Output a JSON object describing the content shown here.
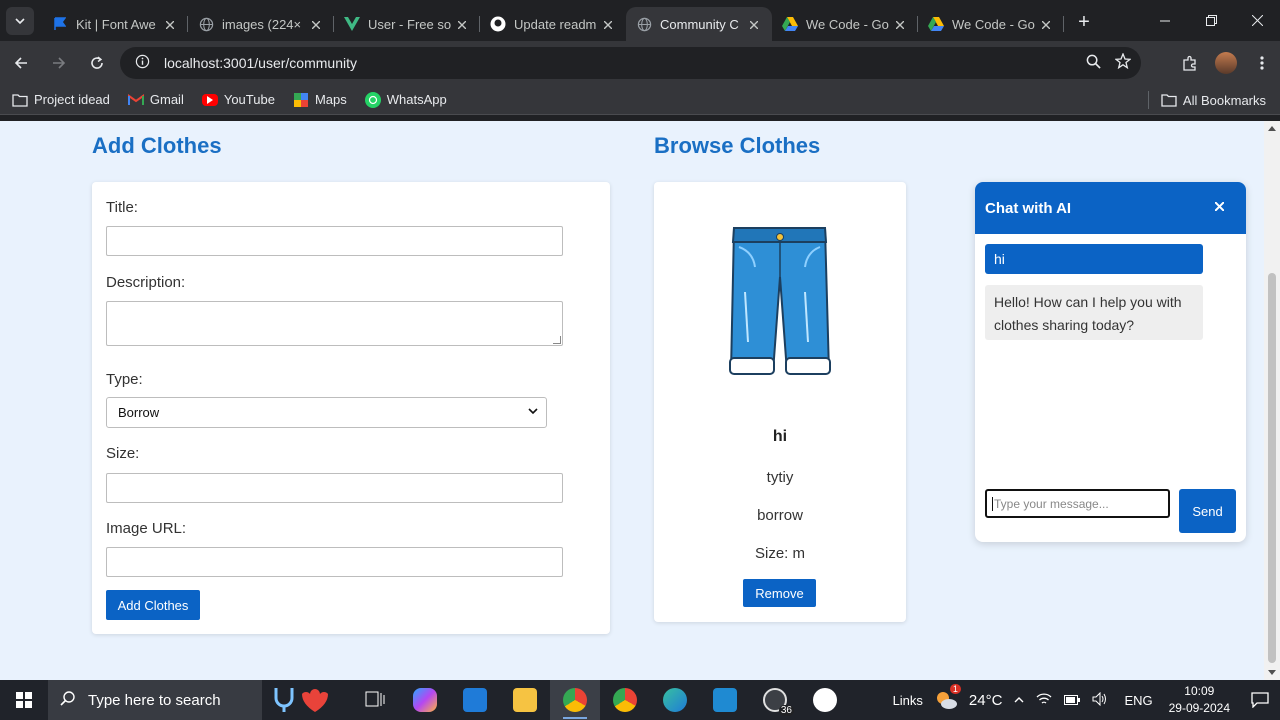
{
  "browser": {
    "tabs": [
      {
        "label": "Kit | Font Awe",
        "icon": "font-awesome-flag-icon",
        "color": "#1e73e8",
        "active": false
      },
      {
        "label": "images (224×",
        "icon": "globe-icon",
        "color": "#9aa0a6",
        "active": false
      },
      {
        "label": "User - Free so",
        "icon": "vue-v-icon",
        "color": "#3fb984",
        "active": false
      },
      {
        "label": "Update readm",
        "icon": "github-icon",
        "color": "#ffffff",
        "active": false
      },
      {
        "label": "Community C",
        "icon": "globe-icon",
        "color": "#9aa0a6",
        "active": true
      },
      {
        "label": "We Code - Go",
        "icon": "google-drive-icon",
        "color": "#f4b400",
        "active": false
      },
      {
        "label": "We Code - Go",
        "icon": "google-drive-icon",
        "color": "#f4b400",
        "active": false
      }
    ],
    "url": "localhost:3001/user/community",
    "bookmarks": [
      {
        "label": "Project idead",
        "icon": "folder-icon"
      },
      {
        "label": "Gmail",
        "icon": "gmail-icon"
      },
      {
        "label": "YouTube",
        "icon": "youtube-icon"
      },
      {
        "label": "Maps",
        "icon": "maps-icon"
      },
      {
        "label": "WhatsApp",
        "icon": "whatsapp-icon"
      }
    ],
    "all_bookmarks": "All Bookmarks"
  },
  "add_clothes": {
    "heading": "Add Clothes",
    "title_label": "Title:",
    "title_value": "",
    "description_label": "Description:",
    "description_value": "",
    "type_label": "Type:",
    "type_selected": "Borrow",
    "size_label": "Size:",
    "size_value": "",
    "image_url_label": "Image URL:",
    "image_url_value": "",
    "submit_label": "Add Clothes"
  },
  "browse": {
    "heading": "Browse Clothes",
    "items": [
      {
        "title": "hi",
        "description": "tytiy",
        "type": "borrow",
        "size": "Size: m",
        "remove_label": "Remove",
        "image": "blue-jeans-image"
      }
    ]
  },
  "chat": {
    "title": "Chat with AI",
    "close": "×",
    "messages": [
      {
        "role": "user",
        "text": "hi"
      },
      {
        "role": "ai",
        "text": "Hello! How can I help you with clothes sharing today?"
      }
    ],
    "input_placeholder": "Type your message...",
    "send_label": "Send"
  },
  "taskbar": {
    "search_placeholder": "Type here to search",
    "whatsapp_badge": "36",
    "links_label": "Links",
    "weather_badge": "1",
    "temperature": "24°C",
    "language": "ENG",
    "time": "10:09",
    "date": "29-09-2024"
  },
  "colors": {
    "accent": "#0b63c5",
    "heading": "#1a6fc4",
    "page_bg": "#e9f2fd"
  }
}
